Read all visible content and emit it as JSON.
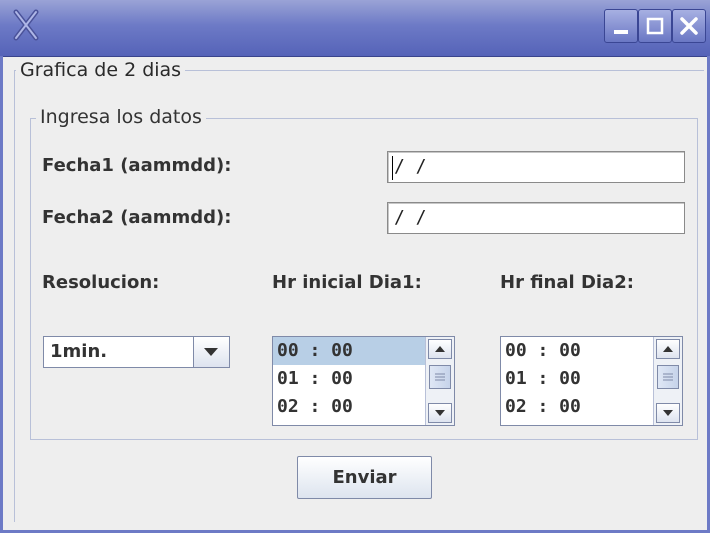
{
  "window": {
    "title": ""
  },
  "titlebar_buttons": {
    "minimize_icon": "minimize-icon",
    "maximize_icon": "maximize-icon",
    "close_icon": "close-icon"
  },
  "outer_group": {
    "title": "Grafica de 2 dias"
  },
  "inner_group": {
    "title": "Ingresa los datos"
  },
  "form": {
    "fecha1": {
      "label": "Fecha1 (aammdd):",
      "value": "/ /"
    },
    "fecha2": {
      "label": "Fecha2 (aammdd):",
      "value": "/ /"
    },
    "resolucion": {
      "label": "Resolucion:",
      "selected": "1min."
    },
    "hr_inicial": {
      "label": "Hr inicial Dia1:",
      "items": [
        "00 : 00",
        "01 : 00",
        "02 : 00"
      ],
      "selected_index": 0
    },
    "hr_final": {
      "label": "Hr final Dia2:",
      "items": [
        "00 : 00",
        "01 : 00",
        "02 : 00"
      ]
    }
  },
  "buttons": {
    "submit_label": "Enviar"
  },
  "colors": {
    "titlebar": "#6d7ac6",
    "background": "#eeeeee",
    "selection": "#b8cfe6",
    "border": "#7f8aa8"
  }
}
